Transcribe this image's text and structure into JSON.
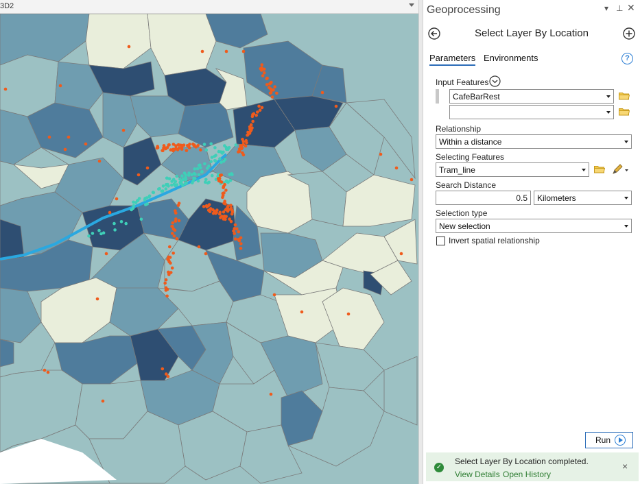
{
  "map": {
    "tab_label": "3D2",
    "colors": {
      "light": "#e9eedb",
      "pale_teal": "#9cc1c3",
      "teal": "#6f9db0",
      "blue": "#4f7c9c",
      "dark": "#2e4e72",
      "cafe_points": "#ef5b1c",
      "tram_stops": "#3fcfb8",
      "tram_line": "#2aa8e0"
    }
  },
  "pane": {
    "title": "Geoprocessing",
    "icons": {
      "pin": "pin-icon",
      "dropdown": "dropdown-icon",
      "close": "close-icon"
    }
  },
  "tool": {
    "title": "Select Layer By Location",
    "back_icon": "back-arrow-icon",
    "add_icon": "add-icon"
  },
  "tabs": {
    "parameters": "Parameters",
    "environments": "Environments",
    "help": "?"
  },
  "params": {
    "input_features_label": "Input Features",
    "input_features_value": "CafeBarRest",
    "input_features_extra": "",
    "relationship_label": "Relationship",
    "relationship_value": "Within a distance",
    "selecting_features_label": "Selecting Features",
    "selecting_features_value": "Tram_line",
    "search_distance_label": "Search Distance",
    "search_distance_value": "0.5",
    "search_distance_unit": "Kilometers",
    "selection_type_label": "Selection type",
    "selection_type_value": "New selection",
    "invert_label": "Invert spatial relationship"
  },
  "run": {
    "label": "Run"
  },
  "status": {
    "message": "Select Layer By Location completed.",
    "view_details": "View Details",
    "open_history": "Open History",
    "close": "×"
  }
}
